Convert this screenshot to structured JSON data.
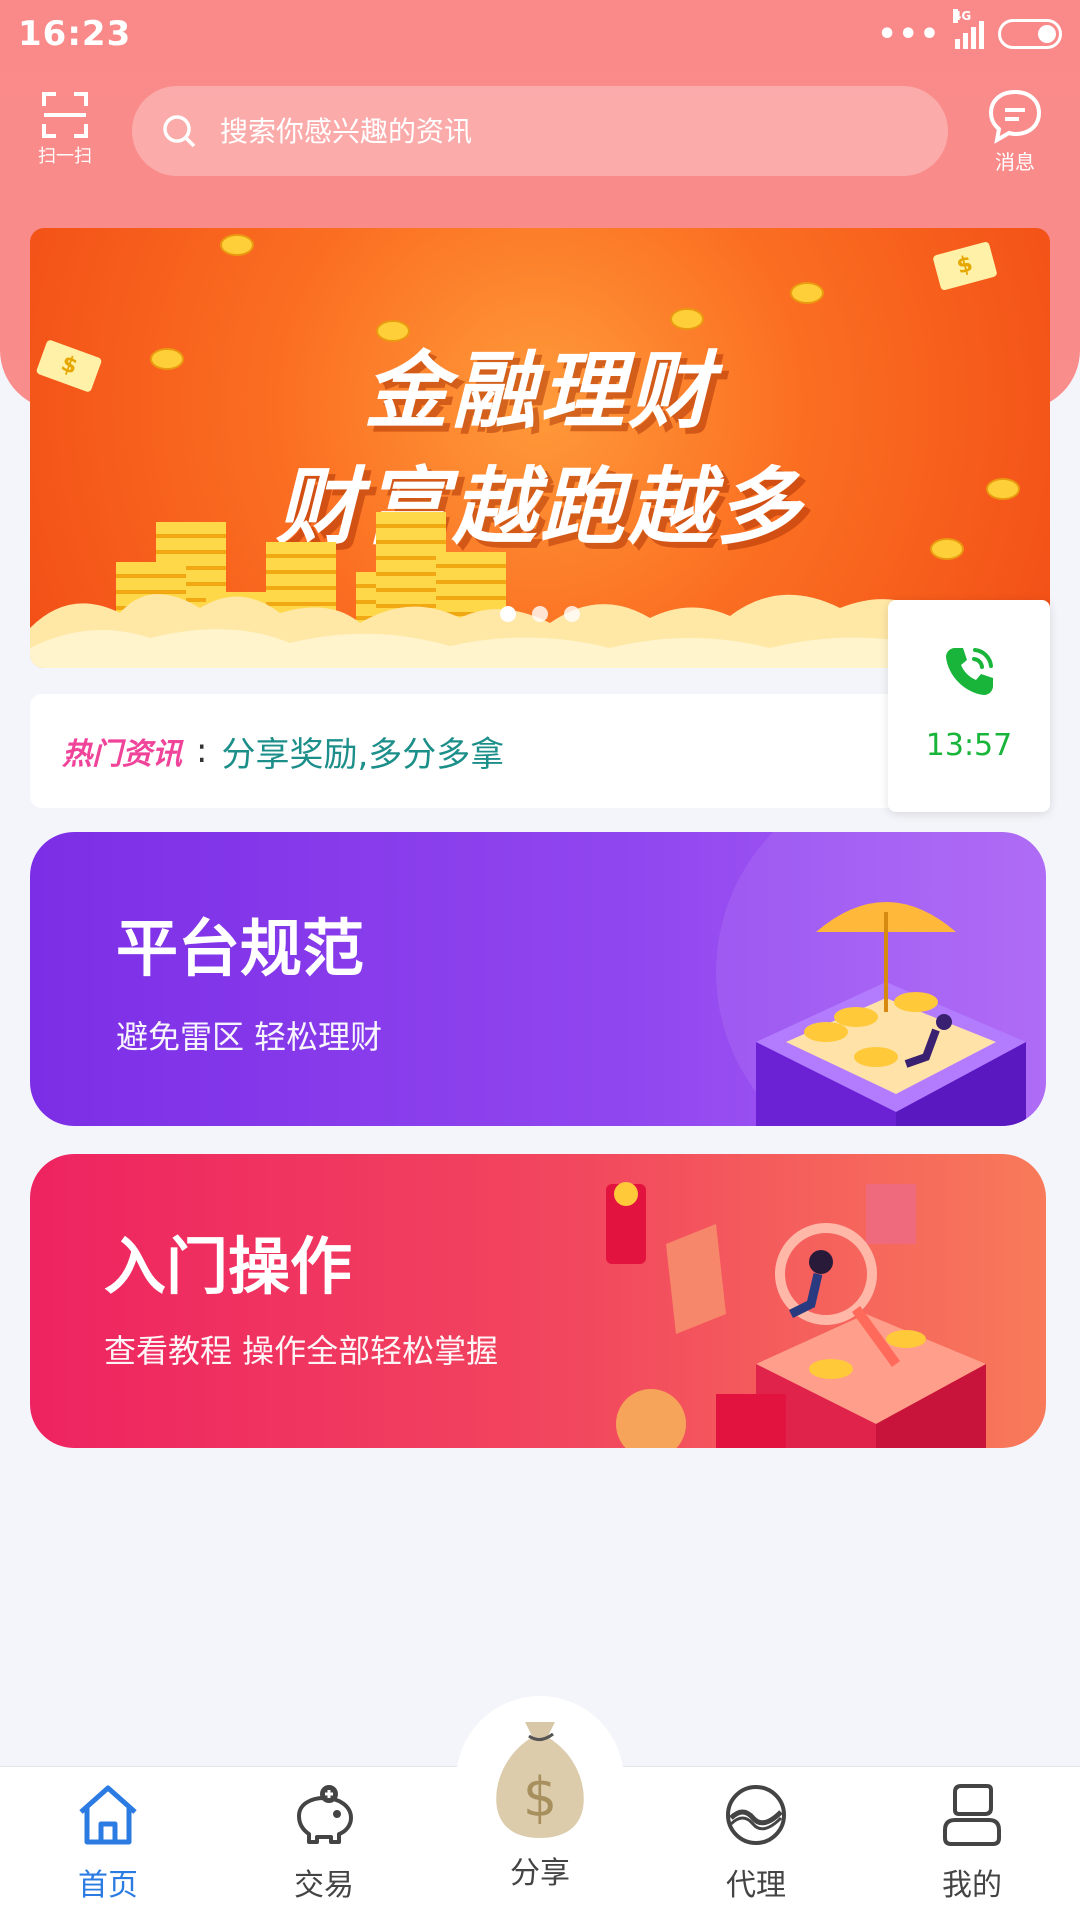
{
  "status_bar": {
    "time": "16:23",
    "network": "4G"
  },
  "header": {
    "scan_label": "扫一扫",
    "search_placeholder": "搜索你感兴趣的资讯",
    "message_label": "消息"
  },
  "banner": {
    "title_line1": "金融理财",
    "title_line2": "财富越跑越多",
    "slide_count": 3,
    "active_slide": 1
  },
  "news": {
    "tag": "热门资讯",
    "colon": ":",
    "text": "分享奖励,多分多拿"
  },
  "call_widget": {
    "time": "13:57"
  },
  "cards": [
    {
      "title": "平台规范",
      "subtitle": "避免雷区 轻松理财"
    },
    {
      "title": "入门操作",
      "subtitle": "查看教程 操作全部轻松掌握"
    }
  ],
  "bottom_nav": [
    {
      "label": "首页",
      "icon": "home-icon",
      "active": true
    },
    {
      "label": "交易",
      "icon": "piggy-bank-icon",
      "active": false
    },
    {
      "label": "分享",
      "icon": "money-bag-icon",
      "active": false
    },
    {
      "label": "代理",
      "icon": "agent-icon",
      "active": false
    },
    {
      "label": "我的",
      "icon": "profile-icon",
      "active": false
    }
  ],
  "colors": {
    "header": "#f98a89",
    "banner": "#f76420",
    "news_tag": "#f0449a",
    "news_text": "#1d8f8a",
    "call_green": "#18b53a",
    "card1": "#8a3eec",
    "card2": "#f0375f",
    "nav_active": "#2b7be3"
  }
}
